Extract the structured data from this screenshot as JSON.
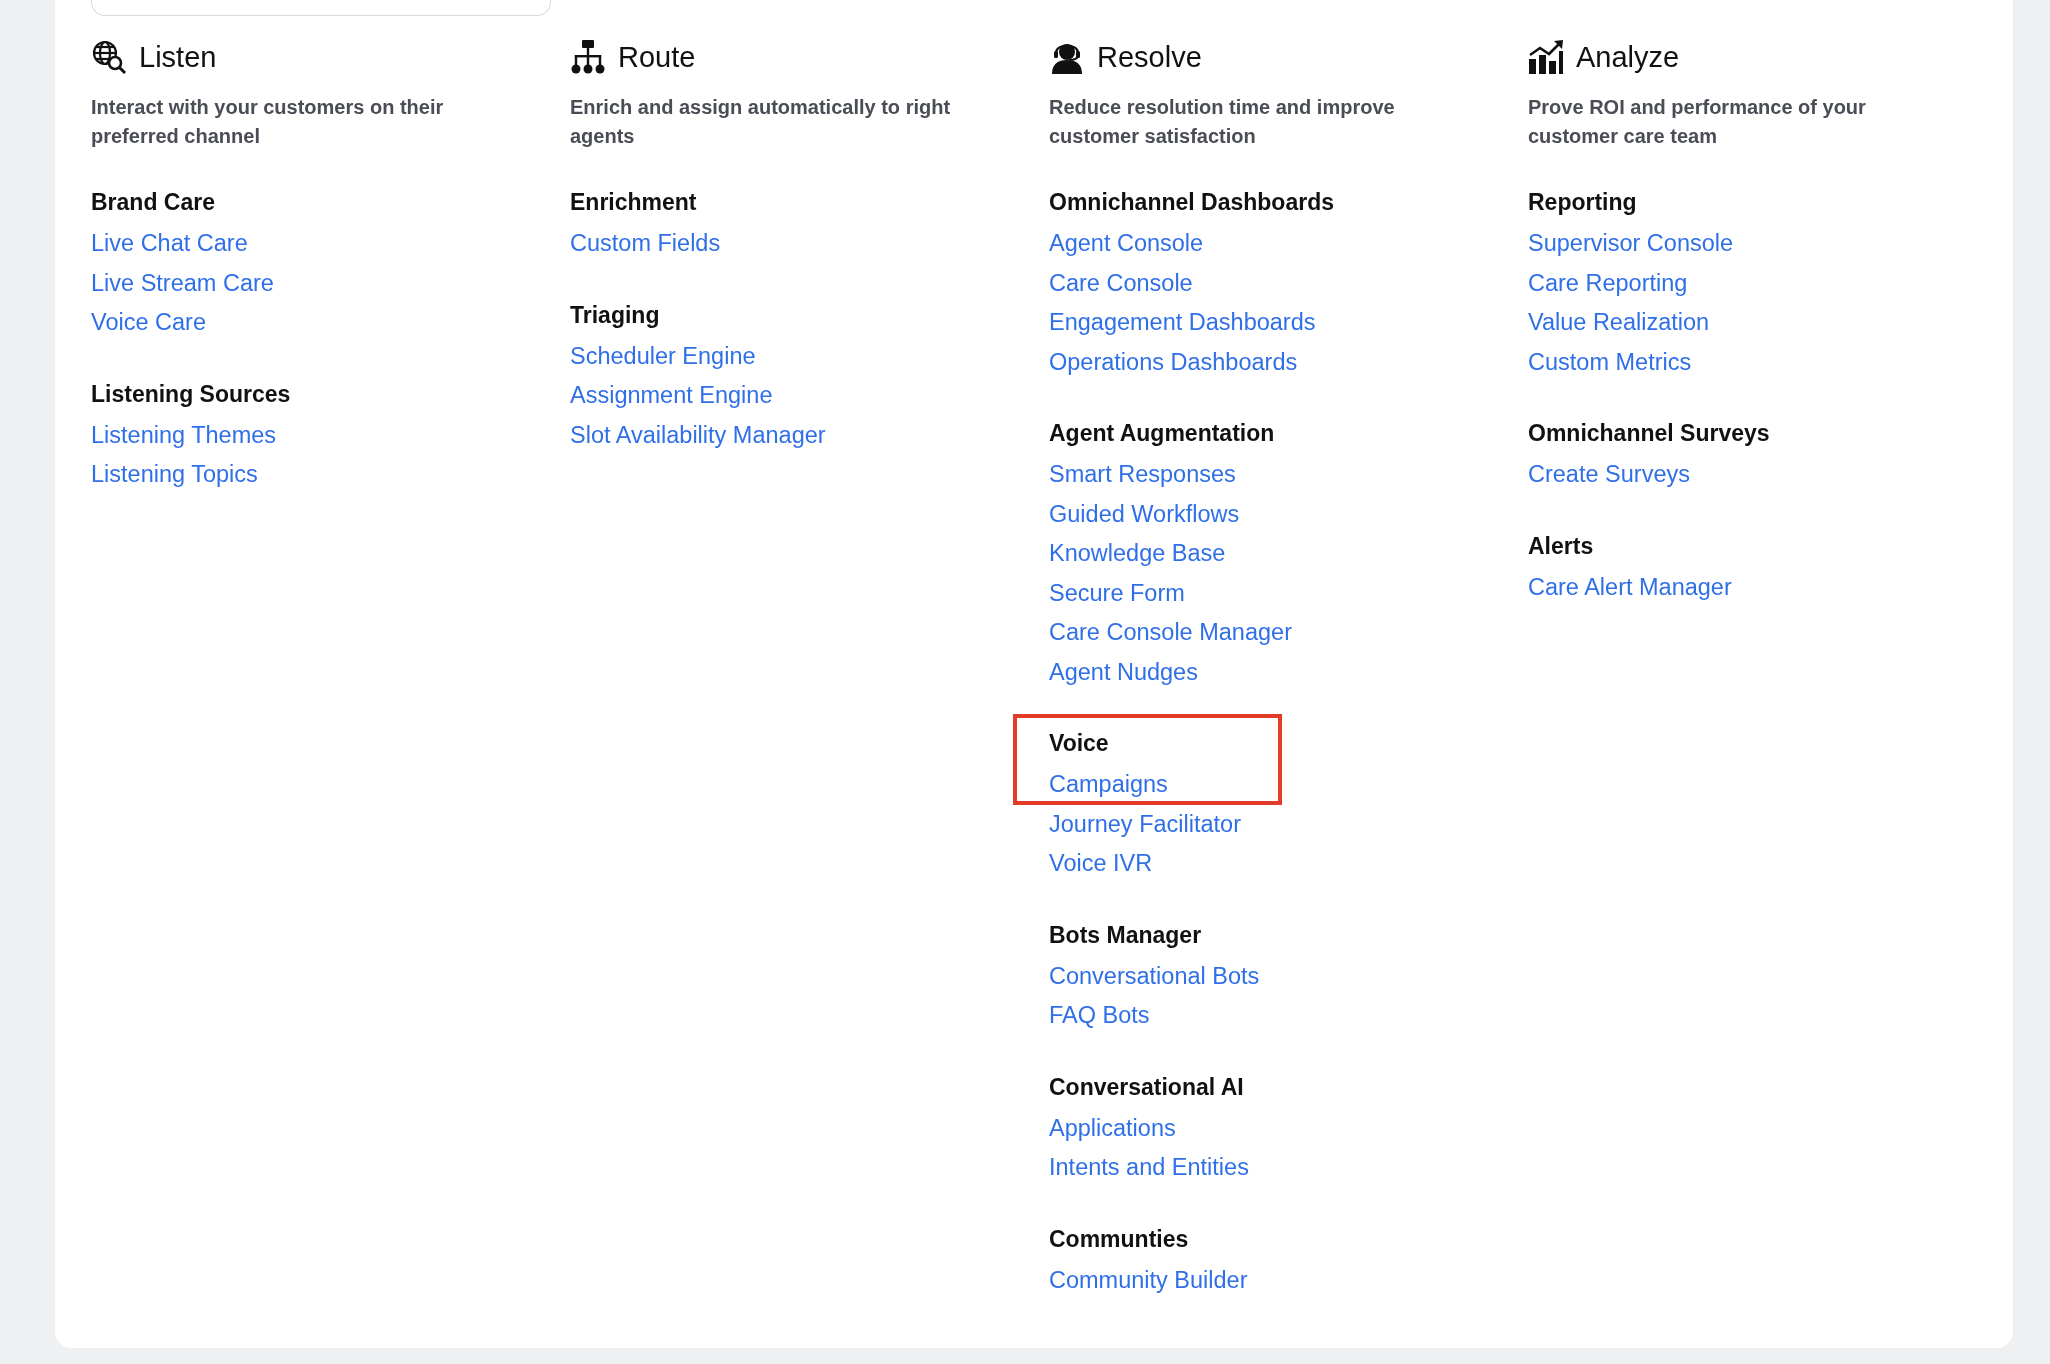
{
  "columns": [
    {
      "title": "Listen",
      "description": "Interact with your customers on their preferred channel",
      "groups": [
        {
          "title": "Brand Care",
          "highlighted": false,
          "links": [
            "Live Chat Care",
            "Live Stream Care",
            "Voice Care"
          ]
        },
        {
          "title": "Listening Sources",
          "highlighted": false,
          "links": [
            "Listening Themes",
            "Listening Topics"
          ]
        }
      ]
    },
    {
      "title": "Route",
      "description": "Enrich and assign automatically to right agents",
      "groups": [
        {
          "title": "Enrichment",
          "highlighted": false,
          "links": [
            "Custom Fields"
          ]
        },
        {
          "title": "Triaging",
          "highlighted": false,
          "links": [
            "Scheduler Engine",
            "Assignment Engine",
            "Slot Availability Manager"
          ]
        }
      ]
    },
    {
      "title": "Resolve",
      "description": "Reduce resolution time and improve customer satisfaction",
      "groups": [
        {
          "title": "Omnichannel Dashboards",
          "highlighted": false,
          "links": [
            "Agent Console",
            "Care Console",
            "Engagement Dashboards",
            "Operations Dashboards"
          ]
        },
        {
          "title": "Agent Augmentation",
          "highlighted": false,
          "links": [
            "Smart Responses",
            "Guided Workflows",
            "Knowledge Base",
            "Secure Form",
            "Care Console Manager",
            "Agent Nudges"
          ]
        },
        {
          "title": "Voice",
          "highlighted": true,
          "links": [
            "Campaigns",
            "Journey Facilitator",
            "Voice IVR"
          ]
        },
        {
          "title": "Bots Manager",
          "highlighted": false,
          "links": [
            "Conversational Bots",
            "FAQ Bots"
          ]
        },
        {
          "title": "Conversational AI",
          "highlighted": false,
          "links": [
            "Applications",
            "Intents and Entities"
          ]
        },
        {
          "title": "Communties",
          "highlighted": false,
          "links": [
            "Community Builder"
          ]
        }
      ]
    },
    {
      "title": "Analyze",
      "description": "Prove ROI and performance of your customer care team",
      "groups": [
        {
          "title": "Reporting",
          "highlighted": false,
          "links": [
            "Supervisor Console",
            "Care Reporting",
            "Value Realization",
            "Custom Metrics"
          ]
        },
        {
          "title": "Omnichannel Surveys",
          "highlighted": false,
          "links": [
            "Create Surveys"
          ]
        },
        {
          "title": "Alerts",
          "highlighted": false,
          "links": [
            "Care Alert Manager"
          ]
        }
      ]
    }
  ]
}
